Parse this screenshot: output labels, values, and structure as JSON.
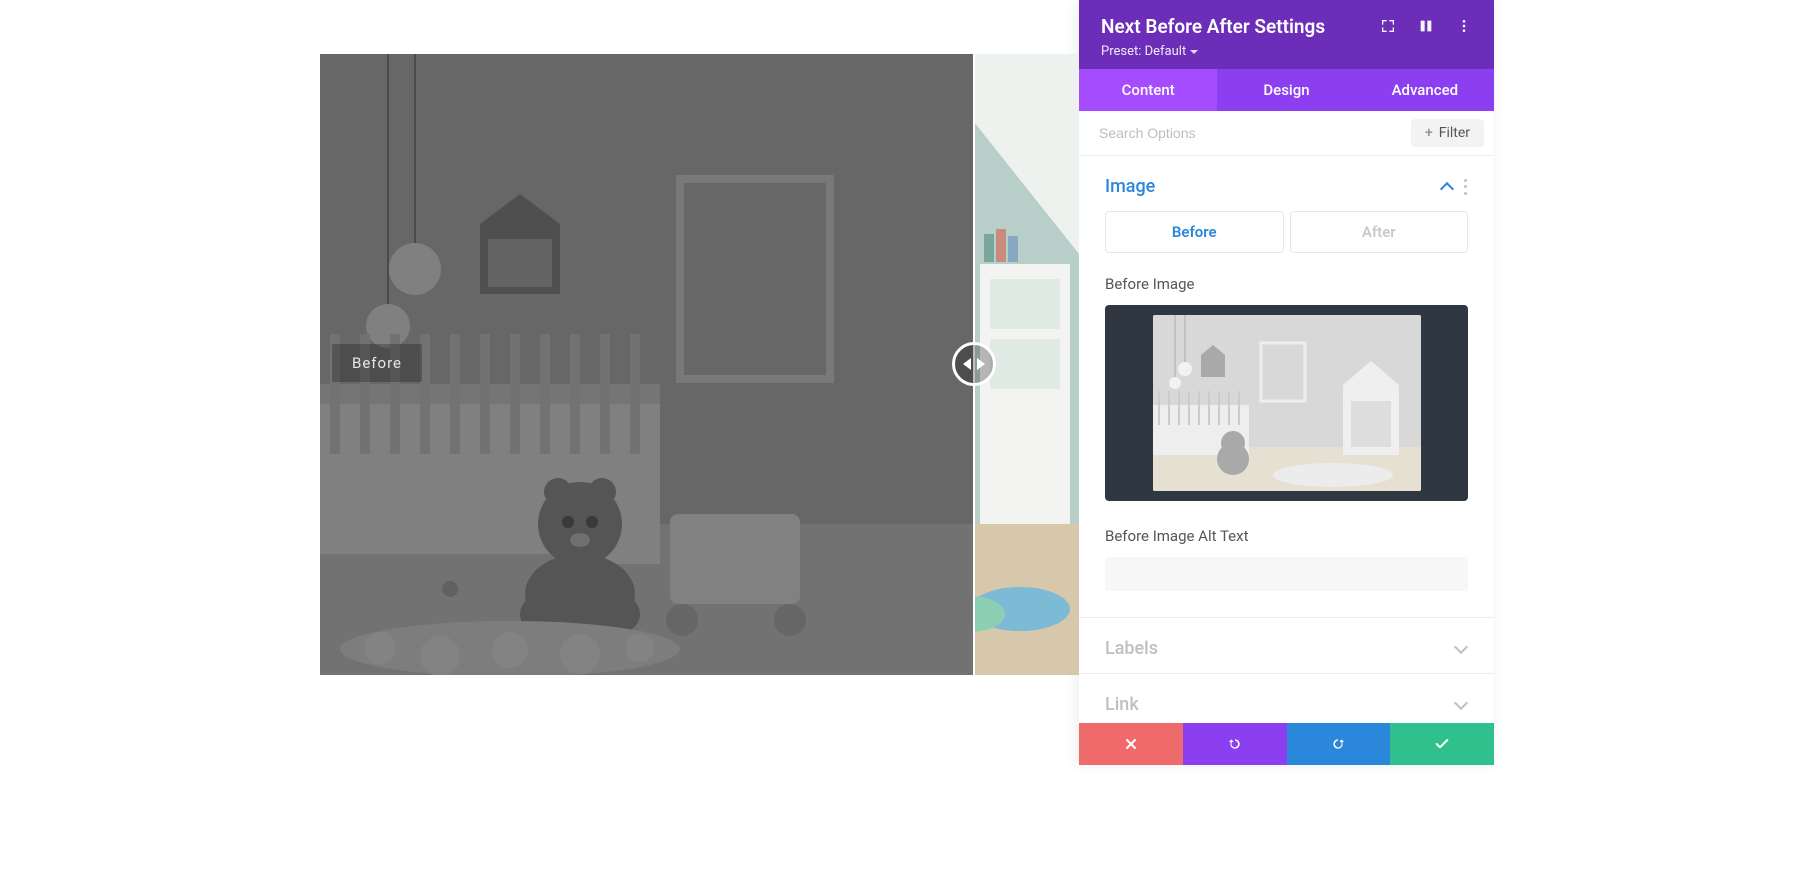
{
  "panel": {
    "title": "Next Before After Settings",
    "preset_label": "Preset: Default",
    "tabs": {
      "content": "Content",
      "design": "Design",
      "advanced": "Advanced"
    },
    "search_placeholder": "Search Options",
    "filter_label": "Filter"
  },
  "sections": {
    "image": {
      "title": "Image",
      "before_tab": "Before",
      "after_tab": "After",
      "before_image_label": "Before Image",
      "before_alt_label": "Before Image Alt Text",
      "before_alt_value": ""
    },
    "labels": {
      "title": "Labels"
    },
    "link": {
      "title": "Link"
    }
  },
  "slider": {
    "before_label": "Before"
  }
}
